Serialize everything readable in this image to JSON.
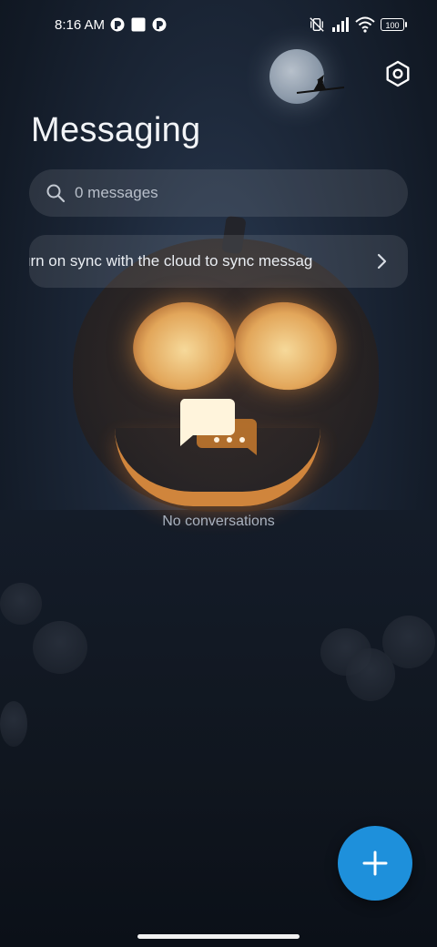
{
  "status_bar": {
    "time": "8:16 AM",
    "battery": "100"
  },
  "header": {
    "title": "Messaging",
    "settings_icon": "settings-hexagon-icon"
  },
  "search": {
    "placeholder": "0 messages",
    "icon": "search-icon"
  },
  "sync_banner": {
    "text": "urn on sync with the cloud to sync messag",
    "icon": "chevron-right-icon"
  },
  "empty_state": {
    "icon": "conversation-bubbles-icon",
    "text": "No conversations"
  },
  "fab": {
    "icon": "plus-icon",
    "color": "#1e90db"
  },
  "colors": {
    "accent": "#1e90db",
    "pumpkin_glow": "#e3903f"
  }
}
